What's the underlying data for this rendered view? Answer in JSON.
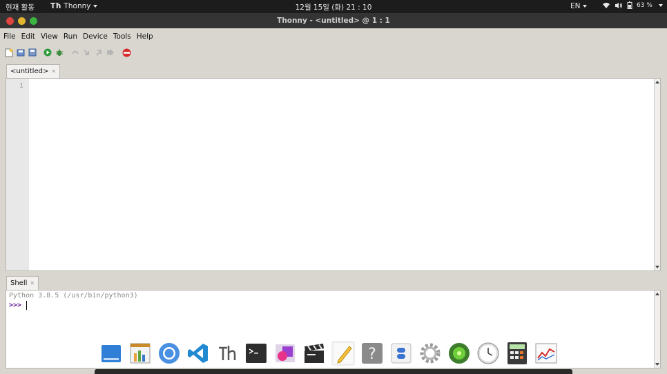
{
  "topbar": {
    "activities": "현재 활동",
    "app": "Thonny",
    "clock": "12월 15일 (화)  21 : 10",
    "lang": "EN",
    "battery": "63 %"
  },
  "window": {
    "title": "Thonny  -  <untitled>  @  1 : 1"
  },
  "menu": [
    "File",
    "Edit",
    "View",
    "Run",
    "Device",
    "Tools",
    "Help"
  ],
  "editor": {
    "tab": "<untitled>",
    "line_number": "1"
  },
  "shell": {
    "tab": "Shell",
    "banner": "Python 3.8.5 (/usr/bin/python3)",
    "prompt": ">>>"
  },
  "colors": {
    "accent_prompt": "#5a0f8a",
    "close": "#e0443e",
    "minimize": "#e2b52d",
    "maximize": "#3cb441"
  }
}
